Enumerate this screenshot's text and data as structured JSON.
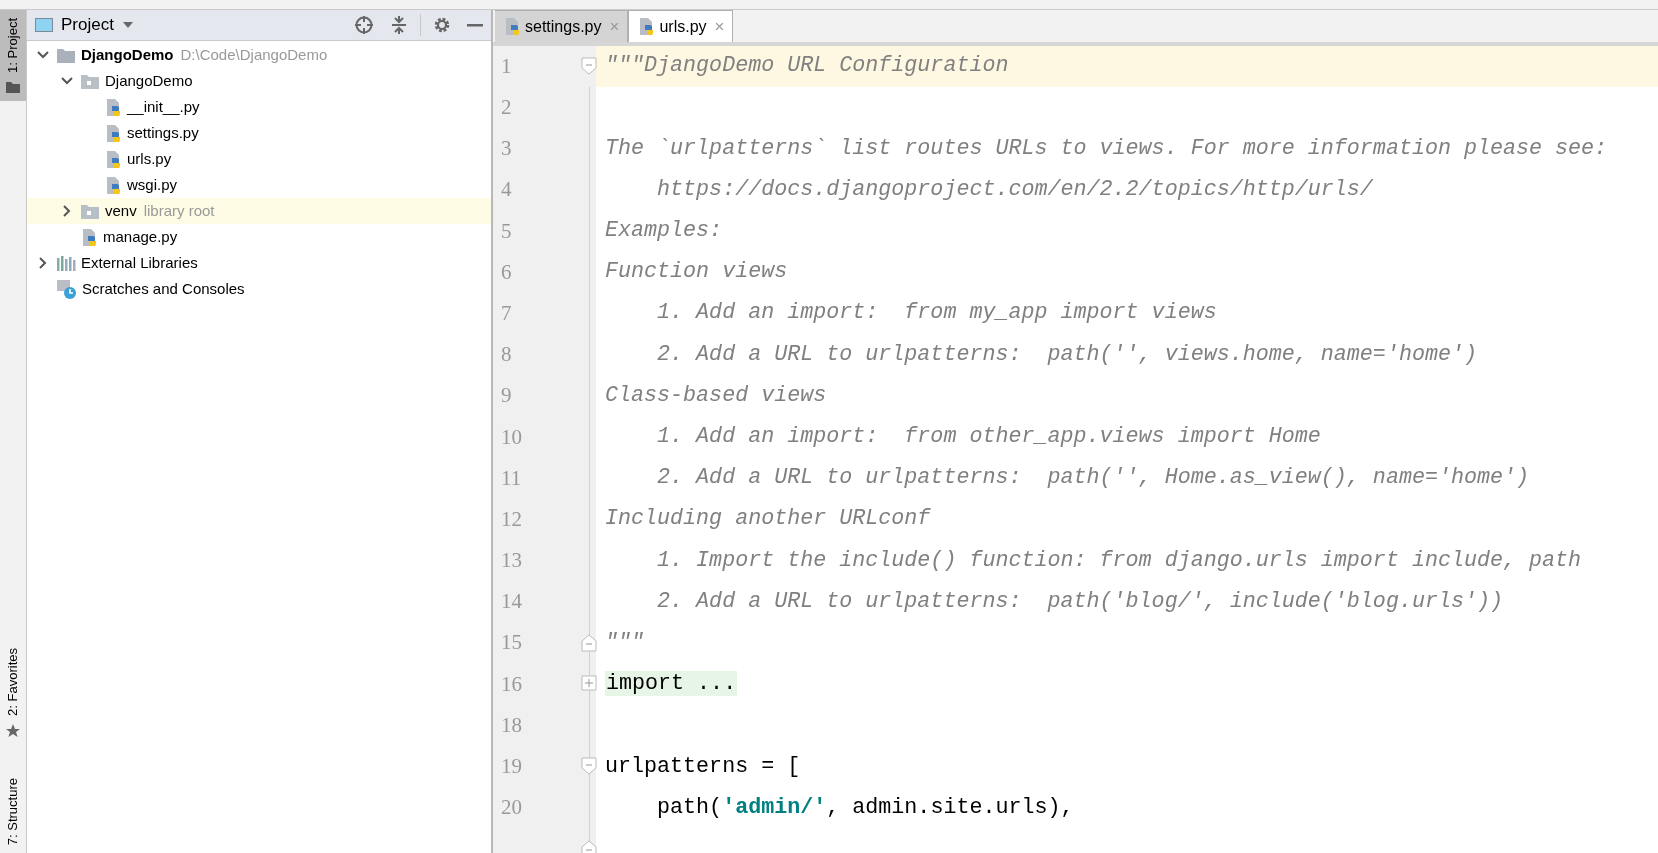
{
  "tool_strip": {
    "tabs": [
      {
        "label": "1: Project",
        "selected": true,
        "kind": "folder"
      },
      {
        "label": "2: Favorites",
        "selected": false,
        "kind": "star"
      },
      {
        "label": "7: Structure",
        "selected": false,
        "kind": "plain"
      }
    ]
  },
  "project_panel": {
    "title": "Project",
    "tree": [
      {
        "label": "DjangoDemo",
        "note": "D:\\Code\\DjangoDemo",
        "kind": "project",
        "expanded": true,
        "highlighted": false,
        "children": [
          {
            "label": "DjangoDemo",
            "kind": "folder",
            "expanded": true,
            "highlighted": false,
            "children": [
              {
                "label": "__init__.py",
                "kind": "python",
                "highlighted": false
              },
              {
                "label": "settings.py",
                "kind": "python",
                "highlighted": false
              },
              {
                "label": "urls.py",
                "kind": "python",
                "highlighted": false
              },
              {
                "label": "wsgi.py",
                "kind": "python",
                "highlighted": false
              }
            ]
          },
          {
            "label": "venv",
            "note": "library root",
            "kind": "folder",
            "expanded": false,
            "highlighted": true
          },
          {
            "label": "manage.py",
            "kind": "python",
            "highlighted": false
          }
        ]
      },
      {
        "label": "External Libraries",
        "kind": "libraries",
        "expanded": false,
        "highlighted": false
      },
      {
        "label": "Scratches and Consoles",
        "kind": "scratches",
        "highlighted": false
      }
    ]
  },
  "editor": {
    "tabs": [
      {
        "label": "settings.py",
        "close": "×",
        "selected": false
      },
      {
        "label": "urls.py",
        "close": "×",
        "selected": true
      }
    ],
    "lines": [
      {
        "number": "1",
        "current": true,
        "kind": "fold_start",
        "segments": [
          {
            "kind": "comment",
            "text": "\"\"\"DjangoDemo URL Configuration"
          }
        ]
      },
      {
        "number": "2",
        "current": false,
        "kind": "blank"
      },
      {
        "number": "3",
        "current": false,
        "segments": [
          {
            "kind": "comment",
            "text": "The `urlpatterns` list routes URLs to views. For more information please see:"
          }
        ]
      },
      {
        "number": "4",
        "current": false,
        "segments": [
          {
            "kind": "comment",
            "text": "    https://docs.djangoproject.com/en/2.2/topics/http/urls/"
          }
        ]
      },
      {
        "number": "5",
        "current": false,
        "segments": [
          {
            "kind": "comment",
            "text": "Examples:"
          }
        ]
      },
      {
        "number": "6",
        "current": false,
        "segments": [
          {
            "kind": "comment",
            "text": "Function views"
          }
        ]
      },
      {
        "number": "7",
        "current": false,
        "segments": [
          {
            "kind": "comment",
            "text": "    1. Add an import:  from my_app import views"
          }
        ]
      },
      {
        "number": "8",
        "current": false,
        "segments": [
          {
            "kind": "comment",
            "text": "    2. Add a URL to urlpatterns:  path('', views.home, name='home')"
          }
        ]
      },
      {
        "number": "9",
        "current": false,
        "segments": [
          {
            "kind": "comment",
            "text": "Class-based views"
          }
        ]
      },
      {
        "number": "10",
        "current": false,
        "segments": [
          {
            "kind": "comment",
            "text": "    1. Add an import:  from other_app.views import Home"
          }
        ]
      },
      {
        "number": "11",
        "current": false,
        "segments": [
          {
            "kind": "comment",
            "text": "    2. Add a URL to urlpatterns:  path('', Home.as_view(), name='home')"
          }
        ]
      },
      {
        "number": "12",
        "current": false,
        "segments": [
          {
            "kind": "comment",
            "text": "Including another URLconf"
          }
        ]
      },
      {
        "number": "13",
        "current": false,
        "segments": [
          {
            "kind": "comment",
            "text": "    1. Import the include() function: from django.urls import include, path"
          }
        ]
      },
      {
        "number": "14",
        "current": false,
        "segments": [
          {
            "kind": "comment",
            "text": "    2. Add a URL to urlpatterns:  path('blog/', include('blog.urls'))"
          }
        ]
      },
      {
        "number": "15",
        "current": false,
        "kind": "fold_end",
        "segments": [
          {
            "kind": "comment",
            "text": "\"\"\""
          }
        ]
      },
      {
        "number": "16",
        "current": false,
        "kind": "folded",
        "segments": [
          {
            "kind": "folded",
            "text": "import ..."
          }
        ]
      },
      {
        "number": "18",
        "current": false,
        "kind": "blank"
      },
      {
        "number": "19",
        "current": false,
        "kind": "fold_start",
        "segments": [
          {
            "kind": "plain",
            "text": "urlpatterns = ["
          }
        ]
      },
      {
        "number": "20",
        "current": false,
        "segments": [
          {
            "kind": "plain",
            "text": "    path("
          },
          {
            "kind": "string",
            "text": "'admin/'"
          },
          {
            "kind": "plain",
            "text": ", admin.site.urls),"
          }
        ]
      },
      {
        "current": false,
        "kind": "fold_end"
      }
    ]
  }
}
